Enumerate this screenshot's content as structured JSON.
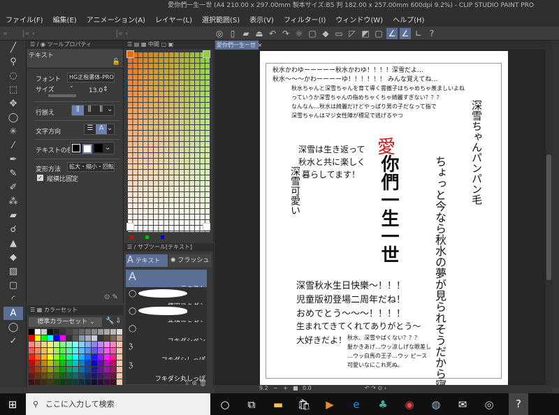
{
  "window": {
    "title": "愛你們一生一世 (A4 210.00 x 297.00mm 製本サイズ:B5 判 182.00 x 257.00mm 600dpi 9.2%) - CLIP STUDIO PAINT PRO"
  },
  "menu": [
    "ファイル(F)",
    "編集(E)",
    "アニメーション(A)",
    "レイヤー(L)",
    "選択範囲(S)",
    "表示(V)",
    "フィルター(I)",
    "ウィンドウ(W)",
    "ヘルプ(H)"
  ],
  "tool_property": {
    "tab": "ツールプロパティ",
    "title": "テキスト",
    "font_label": "フォント",
    "font_value": "HG正楷書体-PRO",
    "size_label": "サイズ",
    "size_value": "13.0",
    "align_label": "行揃え",
    "direction_label": "文字方向",
    "color_label": "テキストの色",
    "transform_label": "変形方法",
    "transform_value": "拡大・縮小・回転",
    "keep_ratio_label": "縦横比固定",
    "keep_ratio_checked": true
  },
  "color_panel": {
    "tab": "中間"
  },
  "color_set": {
    "tab": "カラーセット",
    "selected": "標準カラーセット"
  },
  "sub_tool": {
    "tab": "サブツール[テキスト]",
    "groups": [
      "テキスト",
      "フラッシュ"
    ],
    "items": [
      "テキスト",
      "楕円フキダシ",
      "曲線フキダシ",
      "フキダシペン",
      "フキダシしっぽ",
      "フキダシ丸しっぽ"
    ]
  },
  "document": {
    "tab": "愛你們一生一世"
  },
  "artwork": {
    "lines": [
      "秋水かわゆーーーーー秋水かわゆ！！！！深雪だよ…",
      "秋水～～～かわーーーーゆ！！！！！！ みんな覚えてね…",
      "秋水ちゃんと深雪ちゃんを育て導く雲撤子はちゃめちゃ羨ましいよね",
      "っていうか深雪ちゃんの指めちゃくちゃ綺麗すぎない？？？",
      "なんなん…秋水は綺麗だけどやっぱり男の子だなって指で",
      "深雪ちゃんはマジ女性陣が標足で逃げるやつ",
      "深雪は生き返って",
      "秋水と共に楽しく",
      "暮らしてます！",
      "深雪秋水生日快樂～！！！",
      "児童版初登場二周年だね！",
      "おめでとう～～～！！！！",
      "生まれてきてくれてありがとう～",
      "大好きだよ！",
      "秋水、深雪やばくない？？？",
      "髪かきあげ…ウッ涼しげな眼差し",
      "…ウッ白馬の王子…ウッ ピース",
      "可愛いなにこれ死ぬ。"
    ],
    "title_love": "愛",
    "title_main": "你們一生一世",
    "vertical": [
      "ちょっと今なら秋水の夢が見られそうだから寝る。",
      "深雪ちゃんパンパン毛",
      "深雪可愛い"
    ]
  },
  "status": {
    "zoom": "9.2",
    "angle": "0.0"
  },
  "taskbar": {
    "search_placeholder": "ここに入力して検索"
  }
}
